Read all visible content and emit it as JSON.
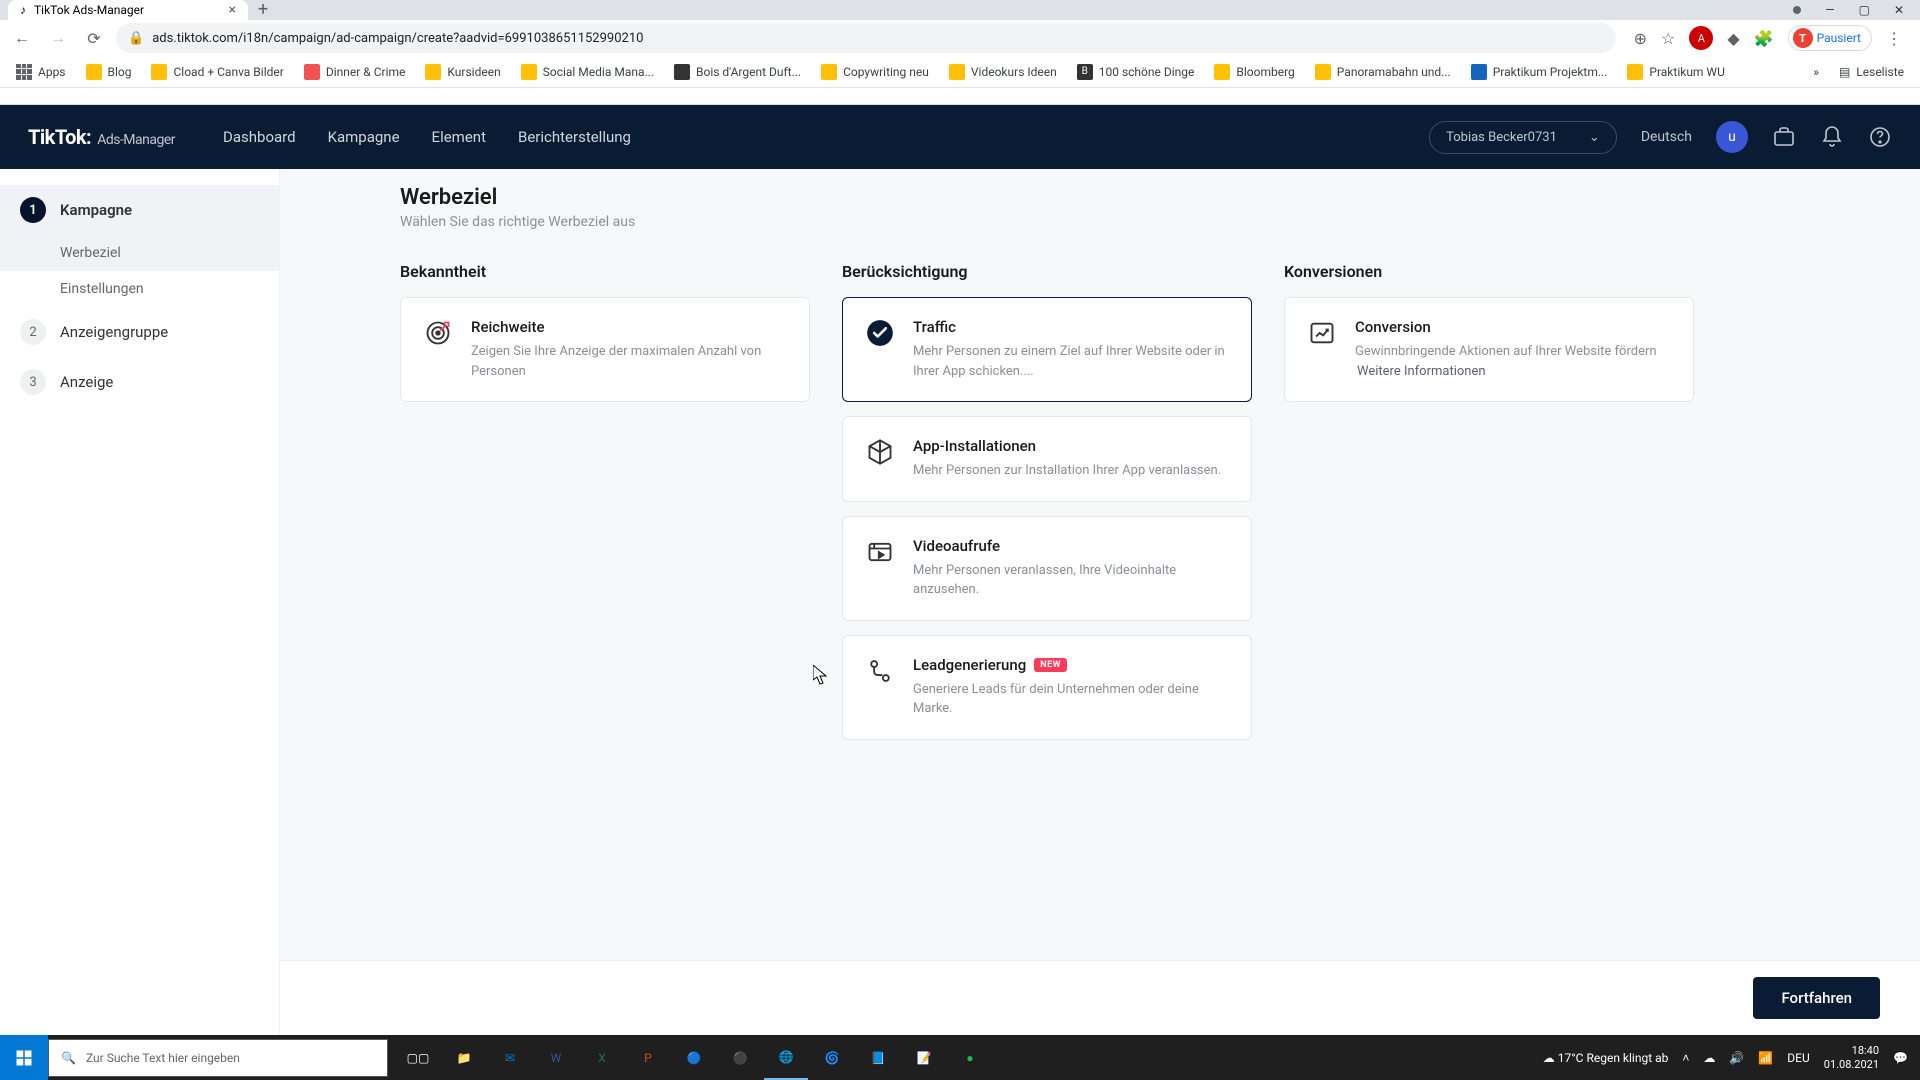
{
  "browser": {
    "tab_title": "TikTok Ads-Manager",
    "url": "ads.tiktok.com/i18n/campaign/ad-campaign/create?aadvid=6991038651152990210",
    "profile_status": "Pausiert",
    "reading_list": "Leseliste"
  },
  "bookmarks": [
    "Apps",
    "Blog",
    "Cload + Canva Bilder",
    "Dinner & Crime",
    "Kursideen",
    "Social Media Mana...",
    "Bois d'Argent Duft...",
    "Copywriting neu",
    "Videokurs Ideen",
    "100 schöne Dinge",
    "Bloomberg",
    "Panoramabahn und...",
    "Praktikum Projektm...",
    "Praktikum WU"
  ],
  "header": {
    "logo": "TikTok:",
    "logo_sub": "Ads-Manager",
    "nav": [
      "Dashboard",
      "Kampagne",
      "Element",
      "Berichterstellung"
    ],
    "account": "Tobias Becker0731",
    "language": "Deutsch"
  },
  "sidebar": {
    "steps": [
      {
        "num": "1",
        "label": "Kampagne",
        "active": true,
        "subs": [
          {
            "label": "Werbeziel",
            "active": true
          },
          {
            "label": "Einstellungen",
            "active": false
          }
        ]
      },
      {
        "num": "2",
        "label": "Anzeigengruppe",
        "active": false
      },
      {
        "num": "3",
        "label": "Anzeige",
        "active": false
      }
    ]
  },
  "content": {
    "heading": "Werbeziel",
    "subheading": "Wählen Sie das richtige Werbeziel aus",
    "columns": [
      {
        "title": "Bekanntheit",
        "cards": [
          {
            "title": "Reichweite",
            "desc": "Zeigen Sie Ihre Anzeige der maximalen Anzahl von Personen",
            "icon": "target"
          }
        ]
      },
      {
        "title": "Berücksichtigung",
        "cards": [
          {
            "title": "Traffic",
            "desc": "Mehr Personen zu einem Ziel auf Ihrer Website oder in Ihrer App schicken....",
            "icon": "check",
            "selected": true
          },
          {
            "title": "App-Installationen",
            "desc": "Mehr Personen zur Installation Ihrer App veranlassen.",
            "icon": "cube"
          },
          {
            "title": "Videoaufrufe",
            "desc": "Mehr Personen veranlassen, Ihre Videoinhalte anzusehen.",
            "icon": "video"
          },
          {
            "title": "Leadgenerierung",
            "desc": "Generiere Leads für dein Unternehmen oder deine Marke.",
            "icon": "lead",
            "badge": "NEW"
          }
        ]
      },
      {
        "title": "Konversionen",
        "cards": [
          {
            "title": "Conversion",
            "desc": "Gewinnbringende Aktionen auf Ihrer Website fördern",
            "link": "Weitere Informationen",
            "icon": "chart"
          }
        ]
      }
    ],
    "continue": "Fortfahren"
  },
  "taskbar": {
    "search_placeholder": "Zur Suche Text hier eingeben",
    "weather": "17°C  Regen klingt ab",
    "time": "18:40",
    "date": "01.08.2021"
  }
}
